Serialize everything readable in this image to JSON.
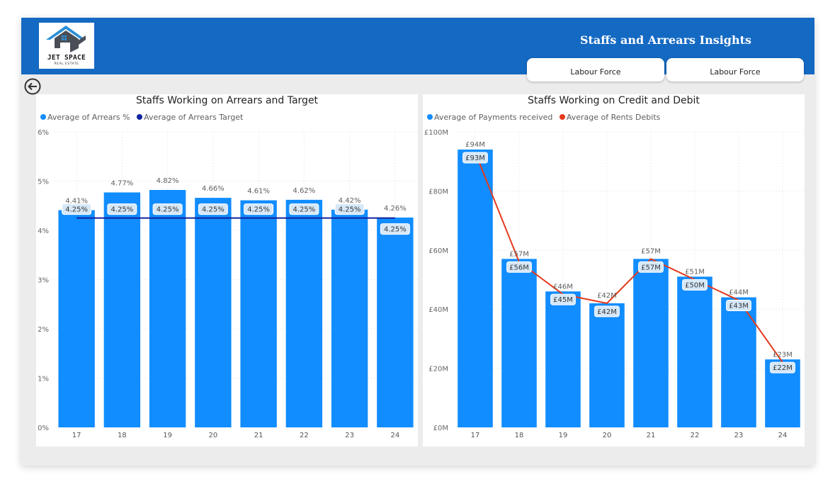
{
  "header": {
    "title": "Staffs and Arrears Insights",
    "logo_text": "JET SPACE",
    "logo_subtext": "REAL ESTATE",
    "tabs": [
      {
        "label": "Labour Force"
      },
      {
        "label": "Labour Force"
      }
    ]
  },
  "colors": {
    "header_bg": "#1469c2",
    "bar": "#118dff",
    "target_line": "#12239e",
    "debit_line": "#e5391c",
    "background": "#ececec"
  },
  "icons": {
    "back": "back-arrow-circle-icon",
    "logo": "house-roof-logo-icon"
  },
  "chart_data": [
    {
      "type": "bar",
      "title": "Staffs Working on Arrears and Target",
      "categories": [
        "17",
        "18",
        "19",
        "20",
        "21",
        "22",
        "23",
        "24"
      ],
      "series": [
        {
          "name": "Average of Arrears %",
          "kind": "bar",
          "values": [
            4.41,
            4.77,
            4.82,
            4.66,
            4.61,
            4.62,
            4.42,
            4.26
          ],
          "labels": [
            "4.41%",
            "4.77%",
            "4.82%",
            "4.66%",
            "4.61%",
            "4.62%",
            "4.42%",
            "4.26%"
          ]
        },
        {
          "name": "Average of Arrears Target",
          "kind": "line",
          "values": [
            4.25,
            4.25,
            4.25,
            4.25,
            4.25,
            4.25,
            4.25,
            4.25
          ],
          "labels": [
            "4.25%",
            "4.25%",
            "4.25%",
            "4.25%",
            "4.25%",
            "4.25%",
            "4.25%",
            "4.25%"
          ]
        }
      ],
      "ylim": [
        0,
        6
      ],
      "yticks": [
        "0%",
        "1%",
        "2%",
        "3%",
        "4%",
        "5%",
        "6%"
      ],
      "grid": true,
      "legend": "top-left"
    },
    {
      "type": "bar",
      "title": "Staffs Working on Credit and Debit",
      "categories": [
        "17",
        "18",
        "19",
        "20",
        "21",
        "22",
        "23",
        "24"
      ],
      "series": [
        {
          "name": "Average of Payments received",
          "kind": "bar",
          "values": [
            94,
            57,
            46,
            42,
            57,
            51,
            44,
            23
          ],
          "labels": [
            "£94M",
            "£57M",
            "£46M",
            "£42M",
            "£57M",
            "£51M",
            "£44M",
            "£23M"
          ]
        },
        {
          "name": "Average of Rents Debits",
          "kind": "line",
          "values": [
            93,
            56,
            45,
            42,
            57,
            50,
            43,
            22
          ],
          "labels": [
            "£93M",
            "£56M",
            "£45M",
            "£42M",
            "£57M",
            "£50M",
            "£43M",
            "£22M"
          ]
        }
      ],
      "ylim": [
        0,
        100
      ],
      "yticks": [
        "£0M",
        "£20M",
        "£40M",
        "£60M",
        "£80M",
        "£100M"
      ],
      "grid": true,
      "legend": "top-left"
    }
  ]
}
